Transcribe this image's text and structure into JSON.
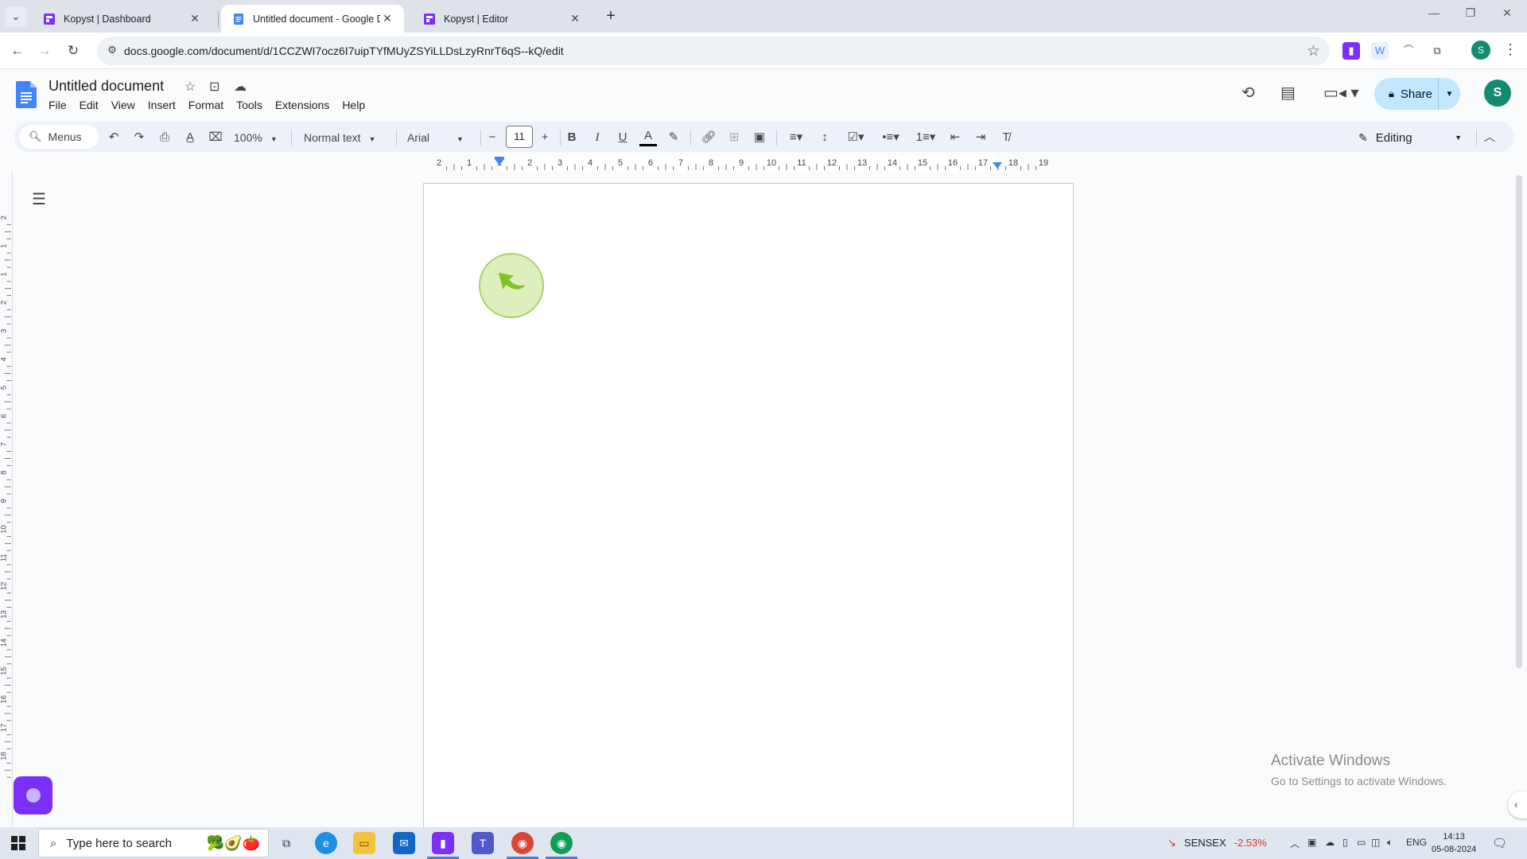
{
  "browser": {
    "tabs": [
      {
        "title": "Kopyst | Dashboard"
      },
      {
        "title": "Untitled document - Google Docs"
      },
      {
        "title": "Kopyst | Editor"
      }
    ],
    "url": "docs.google.com/document/d/1CCZWI7ocz6I7uipTYfMUyZSYiLLDsLzyRnrT6qS--kQ/edit",
    "profile_initial": "S"
  },
  "docs": {
    "title": "Untitled document",
    "menu": [
      "File",
      "Edit",
      "View",
      "Insert",
      "Format",
      "Tools",
      "Extensions",
      "Help"
    ],
    "share_label": "Share",
    "avatar_initial": "S"
  },
  "toolbar": {
    "menus_search": "Menus",
    "zoom": "100%",
    "style": "Normal text",
    "font": "Arial",
    "font_size": "11",
    "mode": "Editing"
  },
  "ruler": {
    "horizontal": [
      "2",
      "1",
      "1",
      "2",
      "3",
      "4",
      "5",
      "6",
      "7",
      "8",
      "9",
      "10",
      "11",
      "12",
      "13",
      "14",
      "15",
      "16",
      "17",
      "18",
      "19"
    ],
    "vertical": [
      "2",
      "1",
      "1",
      "2",
      "3",
      "4",
      "5",
      "6",
      "7",
      "8",
      "9",
      "10",
      "11",
      "12",
      "13",
      "14",
      "15",
      "16",
      "17",
      "18"
    ]
  },
  "watermark": {
    "line1": "Activate Windows",
    "line2": "Go to Settings to activate Windows."
  },
  "taskbar": {
    "search_placeholder": "Type here to search",
    "ticker_name": "SENSEX",
    "ticker_change": "-2.53%",
    "language": "ENG",
    "time": "14:13",
    "date": "05-08-2024"
  },
  "colors": {
    "kopyst_purple": "#7b2ff7",
    "docs_blue": "#4285f4",
    "share_bg": "#c2e7ff",
    "avatar_green": "#138a72"
  }
}
